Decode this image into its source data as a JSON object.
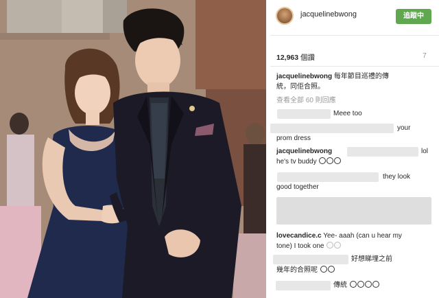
{
  "post": {
    "username": "jacquelinebwong",
    "follow_label": "追蹤中",
    "likes_count": "12,963",
    "likes_suffix": "個讚",
    "more_indicator": "7",
    "caption_user": "jacquelinebwong",
    "caption_line1": "每年節目巡禮的傳",
    "caption_line2": "統，同佢合照。",
    "view_all": "查看全部 60 則回應"
  },
  "comments": {
    "c1_text": "Meee too",
    "c2_text": "your",
    "c2_line2": "prom dress",
    "c3_user": "jacquelinebwong",
    "c3_text": "lol",
    "c3_line2": "he's tv buddy",
    "c4_text": "they look",
    "c4_line2": "good together",
    "c5_user": "lovecandice.c",
    "c5_text": "Yee- aaah (can u hear my",
    "c5_line2": "tone) I took one",
    "c6_text": "好想睇埋之前",
    "c6_line2": "幾年的合照呢",
    "c7_text": "傳統"
  },
  "colors": {
    "follow_button": "#60a84f",
    "suit": "#1b1a26",
    "dress": "#1f2a4d",
    "pocket_square": "#8b5a6e"
  },
  "icons": {
    "emoji": "smiley-face-icon"
  }
}
